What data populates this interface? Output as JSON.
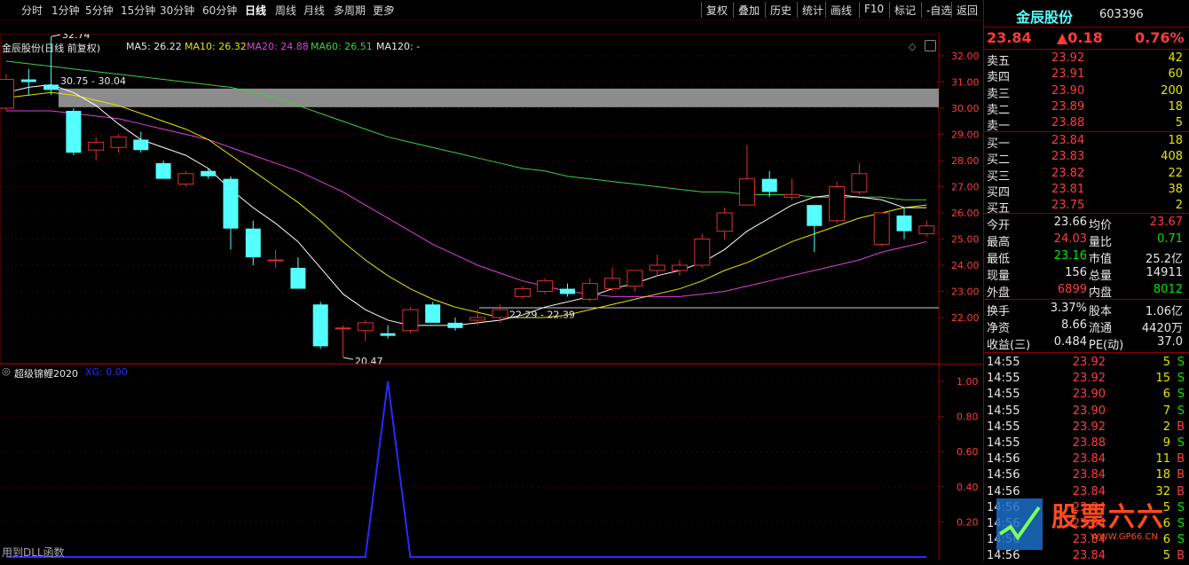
{
  "toolbar": {
    "periods": [
      "分时",
      "1分钟",
      "5分钟",
      "15分钟",
      "30分钟",
      "60分钟",
      "日线",
      "周线",
      "月线",
      "多周期",
      "更多"
    ],
    "active_period": "日线",
    "actions": [
      "复权",
      "叠加",
      "历史",
      "统计",
      "画线",
      "F10",
      "标记",
      "-自选",
      "返回"
    ]
  },
  "chart": {
    "title": "金辰股份(日线 前复权)",
    "ma5": "MA5: 26.22",
    "ma10": "MA10: 26.32",
    "ma20": "MA20: 24.88",
    "ma60": "MA60: 26.51",
    "ma120": "MA120: -",
    "annotations": {
      "high": "32.74",
      "gap": "30.75 - 30.04",
      "low": "20.47",
      "gap2": "22.29 - 22.39"
    },
    "colors": {
      "ma5": "#ffffff",
      "ma10": "#e6e600",
      "ma20": "#e040e0",
      "ma60": "#40d040",
      "up": "#e03030",
      "down": "#54ffff"
    }
  },
  "chart_data": [
    {
      "type": "candlestick",
      "title": "金辰股份(日线 前复权)",
      "ylim": [
        20.0,
        33.0
      ],
      "y_ticks": [
        "32.00",
        "31.00",
        "30.00",
        "29.00",
        "28.00",
        "27.00",
        "26.00",
        "25.00",
        "24.00",
        "23.00",
        "22.00"
      ],
      "candles": [
        {
          "o": 30.0,
          "h": 31.3,
          "l": 29.9,
          "c": 31.1
        },
        {
          "o": 31.1,
          "h": 31.5,
          "l": 30.5,
          "c": 31.0
        },
        {
          "o": 30.9,
          "h": 32.74,
          "l": 30.5,
          "c": 30.7
        },
        {
          "o": 29.9,
          "h": 30.0,
          "l": 28.2,
          "c": 28.3
        },
        {
          "o": 28.4,
          "h": 28.9,
          "l": 28.0,
          "c": 28.7
        },
        {
          "o": 28.5,
          "h": 29.0,
          "l": 28.3,
          "c": 28.9
        },
        {
          "o": 28.8,
          "h": 29.1,
          "l": 28.3,
          "c": 28.4
        },
        {
          "o": 27.9,
          "h": 28.0,
          "l": 27.3,
          "c": 27.3
        },
        {
          "o": 27.1,
          "h": 27.6,
          "l": 27.0,
          "c": 27.5
        },
        {
          "o": 27.6,
          "h": 27.7,
          "l": 27.3,
          "c": 27.4
        },
        {
          "o": 27.3,
          "h": 27.4,
          "l": 24.6,
          "c": 25.4
        },
        {
          "o": 25.4,
          "h": 25.7,
          "l": 24.0,
          "c": 24.3
        },
        {
          "o": 24.2,
          "h": 24.6,
          "l": 23.9,
          "c": 24.2
        },
        {
          "o": 23.9,
          "h": 24.3,
          "l": 23.1,
          "c": 23.1
        },
        {
          "o": 22.5,
          "h": 22.6,
          "l": 20.8,
          "c": 20.9
        },
        {
          "o": 21.6,
          "h": 21.7,
          "l": 20.47,
          "c": 21.6
        },
        {
          "o": 21.5,
          "h": 21.9,
          "l": 21.1,
          "c": 21.8
        },
        {
          "o": 21.4,
          "h": 21.7,
          "l": 21.2,
          "c": 21.3
        },
        {
          "o": 21.5,
          "h": 22.4,
          "l": 21.4,
          "c": 22.3
        },
        {
          "o": 22.5,
          "h": 22.6,
          "l": 21.8,
          "c": 21.8
        },
        {
          "o": 21.8,
          "h": 22.0,
          "l": 21.5,
          "c": 21.6
        },
        {
          "o": 21.9,
          "h": 22.3,
          "l": 21.7,
          "c": 22.0
        },
        {
          "o": 22.0,
          "h": 22.5,
          "l": 21.8,
          "c": 22.3
        },
        {
          "o": 22.8,
          "h": 23.2,
          "l": 22.7,
          "c": 23.1
        },
        {
          "o": 23.0,
          "h": 23.5,
          "l": 22.9,
          "c": 23.4
        },
        {
          "o": 23.1,
          "h": 23.3,
          "l": 22.8,
          "c": 22.9
        },
        {
          "o": 22.7,
          "h": 23.5,
          "l": 22.6,
          "c": 23.3
        },
        {
          "o": 23.1,
          "h": 23.9,
          "l": 23.0,
          "c": 23.5
        },
        {
          "o": 23.2,
          "h": 23.8,
          "l": 23.0,
          "c": 23.8
        },
        {
          "o": 23.8,
          "h": 24.4,
          "l": 23.6,
          "c": 24.0
        },
        {
          "o": 23.8,
          "h": 24.2,
          "l": 23.6,
          "c": 24.0
        },
        {
          "o": 24.0,
          "h": 25.2,
          "l": 23.9,
          "c": 25.0
        },
        {
          "o": 25.3,
          "h": 26.2,
          "l": 25.0,
          "c": 26.0
        },
        {
          "o": 26.3,
          "h": 28.6,
          "l": 26.3,
          "c": 27.3
        },
        {
          "o": 27.3,
          "h": 27.6,
          "l": 26.6,
          "c": 26.8
        },
        {
          "o": 26.6,
          "h": 27.3,
          "l": 26.5,
          "c": 26.7
        },
        {
          "o": 26.3,
          "h": 26.3,
          "l": 24.5,
          "c": 25.5
        },
        {
          "o": 25.7,
          "h": 27.2,
          "l": 25.6,
          "c": 27.0
        },
        {
          "o": 26.8,
          "h": 27.9,
          "l": 26.7,
          "c": 27.5
        },
        {
          "o": 24.8,
          "h": 26.0,
          "l": 24.7,
          "c": 26.0
        },
        {
          "o": 25.9,
          "h": 26.2,
          "l": 25.0,
          "c": 25.3
        },
        {
          "o": 25.2,
          "h": 25.7,
          "l": 25.1,
          "c": 25.5
        }
      ],
      "ma5": [
        30.6,
        30.8,
        30.9,
        30.6,
        30.1,
        29.4,
        28.8,
        28.5,
        28.2,
        27.7,
        26.9,
        26.2,
        25.6,
        24.9,
        23.9,
        22.9,
        22.3,
        21.9,
        21.7,
        21.7,
        21.7,
        21.8,
        21.9,
        22.1,
        22.4,
        22.6,
        22.8,
        23.1,
        23.3,
        23.6,
        23.8,
        24.1,
        24.6,
        25.3,
        25.8,
        26.3,
        26.6,
        26.7,
        26.6,
        26.5,
        26.2,
        26.2
      ],
      "ma10": [
        30.4,
        30.5,
        30.6,
        30.5,
        30.3,
        30.1,
        29.8,
        29.5,
        29.2,
        28.8,
        28.2,
        27.6,
        27.0,
        26.4,
        25.7,
        24.9,
        24.2,
        23.6,
        23.1,
        22.7,
        22.4,
        22.2,
        22.0,
        22.0,
        22.0,
        22.1,
        22.3,
        22.5,
        22.7,
        22.9,
        23.1,
        23.4,
        23.8,
        24.1,
        24.5,
        24.9,
        25.2,
        25.5,
        25.8,
        26.0,
        26.2,
        26.3
      ],
      "ma20": [
        29.9,
        29.9,
        29.9,
        29.8,
        29.7,
        29.6,
        29.4,
        29.2,
        29.0,
        28.8,
        28.5,
        28.2,
        27.9,
        27.6,
        27.2,
        26.8,
        26.3,
        25.8,
        25.3,
        24.8,
        24.4,
        24.0,
        23.7,
        23.4,
        23.2,
        23.0,
        22.9,
        22.8,
        22.8,
        22.8,
        22.8,
        22.9,
        23.0,
        23.2,
        23.4,
        23.6,
        23.8,
        24.0,
        24.2,
        24.5,
        24.7,
        24.9
      ],
      "ma60": [
        31.8,
        31.7,
        31.6,
        31.5,
        31.4,
        31.3,
        31.2,
        31.1,
        31.0,
        30.9,
        30.8,
        30.6,
        30.4,
        30.1,
        29.8,
        29.5,
        29.2,
        28.9,
        28.7,
        28.5,
        28.3,
        28.1,
        27.9,
        27.7,
        27.6,
        27.4,
        27.3,
        27.2,
        27.1,
        27.0,
        26.9,
        26.8,
        26.8,
        26.7,
        26.7,
        26.7,
        26.6,
        26.6,
        26.6,
        26.6,
        26.5,
        26.5
      ]
    },
    {
      "type": "line",
      "title": "超级锦鲤2020",
      "legend": "XG: 0.00",
      "ylim": [
        0,
        1.08
      ],
      "y_ticks": [
        "1.00",
        "0.80",
        "0.60",
        "0.40",
        "0.20"
      ],
      "x": [
        0,
        1,
        2,
        3,
        4,
        5,
        6,
        7,
        8,
        9,
        10,
        11,
        12,
        13,
        14,
        15,
        16,
        17,
        18,
        19,
        20,
        21,
        22,
        23,
        24,
        25,
        26,
        27,
        28,
        29,
        30,
        31,
        32,
        33,
        34,
        35,
        36,
        37,
        38,
        39,
        40,
        41
      ],
      "values": [
        0,
        0,
        0,
        0,
        0,
        0,
        0,
        0,
        0,
        0,
        0,
        0,
        0,
        0,
        0,
        0,
        0,
        1,
        0,
        0,
        0,
        0,
        0,
        0,
        0,
        0,
        0,
        0,
        0,
        0,
        0,
        0,
        0,
        0,
        0,
        0,
        0,
        0,
        0,
        0,
        0,
        0
      ]
    }
  ],
  "sub_footer": "用到DLL函数",
  "panel": {
    "name": "金辰股份",
    "code": "603396",
    "price": "23.84",
    "change": "▲0.18",
    "pct": "0.76%",
    "sells": [
      {
        "label": "卖五",
        "price": "23.92",
        "vol": "42"
      },
      {
        "label": "卖四",
        "price": "23.91",
        "vol": "60"
      },
      {
        "label": "卖三",
        "price": "23.90",
        "vol": "200"
      },
      {
        "label": "卖二",
        "price": "23.89",
        "vol": "18"
      },
      {
        "label": "卖一",
        "price": "23.88",
        "vol": "5"
      }
    ],
    "buys": [
      {
        "label": "买一",
        "price": "23.84",
        "vol": "18"
      },
      {
        "label": "买二",
        "price": "23.83",
        "vol": "408"
      },
      {
        "label": "买三",
        "price": "23.82",
        "vol": "22"
      },
      {
        "label": "买四",
        "price": "23.81",
        "vol": "38"
      },
      {
        "label": "买五",
        "price": "23.75",
        "vol": "2"
      }
    ],
    "stats": [
      {
        "l1": "今开",
        "v1": "23.66",
        "l2": "均价",
        "v2": "23.67",
        "c1": "white",
        "c2": "red"
      },
      {
        "l1": "最高",
        "v1": "24.03",
        "l2": "量比",
        "v2": "0.71",
        "c1": "red",
        "c2": "green"
      },
      {
        "l1": "最低",
        "v1": "23.16",
        "l2": "市值",
        "v2": "25.2亿",
        "c1": "green",
        "c2": "white"
      },
      {
        "l1": "现量",
        "v1": "156",
        "l2": "总量",
        "v2": "14911",
        "c1": "white",
        "c2": "white"
      },
      {
        "l1": "外盘",
        "v1": "6899",
        "l2": "内盘",
        "v2": "8012",
        "c1": "red",
        "c2": "green"
      }
    ],
    "fin": [
      {
        "l1": "换手",
        "v1": "3.37%",
        "l2": "股本",
        "v2": "1.06亿"
      },
      {
        "l1": "净资",
        "v1": "8.66",
        "l2": "流通",
        "v2": "4420万"
      },
      {
        "l1": "收益(三)",
        "v1": "0.484",
        "l2": "PE(动)",
        "v2": "37.0"
      }
    ],
    "ticks": [
      {
        "t": "14:55",
        "p": "23.92",
        "v": "5",
        "s": "S"
      },
      {
        "t": "14:55",
        "p": "23.92",
        "v": "15",
        "s": "S"
      },
      {
        "t": "14:55",
        "p": "23.90",
        "v": "6",
        "s": "S"
      },
      {
        "t": "14:55",
        "p": "23.90",
        "v": "7",
        "s": "S"
      },
      {
        "t": "14:55",
        "p": "23.92",
        "v": "2",
        "s": "B"
      },
      {
        "t": "14:55",
        "p": "23.88",
        "v": "9",
        "s": "S"
      },
      {
        "t": "14:56",
        "p": "23.84",
        "v": "11",
        "s": "B"
      },
      {
        "t": "14:56",
        "p": "23.84",
        "v": "18",
        "s": "B"
      },
      {
        "t": "14:56",
        "p": "23.84",
        "v": "32",
        "s": "B"
      },
      {
        "t": "14:56",
        "p": "23.84",
        "v": "5",
        "s": "S"
      },
      {
        "t": "14:56",
        "p": "23.84",
        "v": "6",
        "s": "S"
      },
      {
        "t": "14:56",
        "p": "23.84",
        "v": "6",
        "s": "S"
      },
      {
        "t": "14:56",
        "p": "23.84",
        "v": "5",
        "s": "B"
      }
    ],
    "watermark": "股票六六",
    "watermark_sub": "WWW.GP66.CN"
  }
}
